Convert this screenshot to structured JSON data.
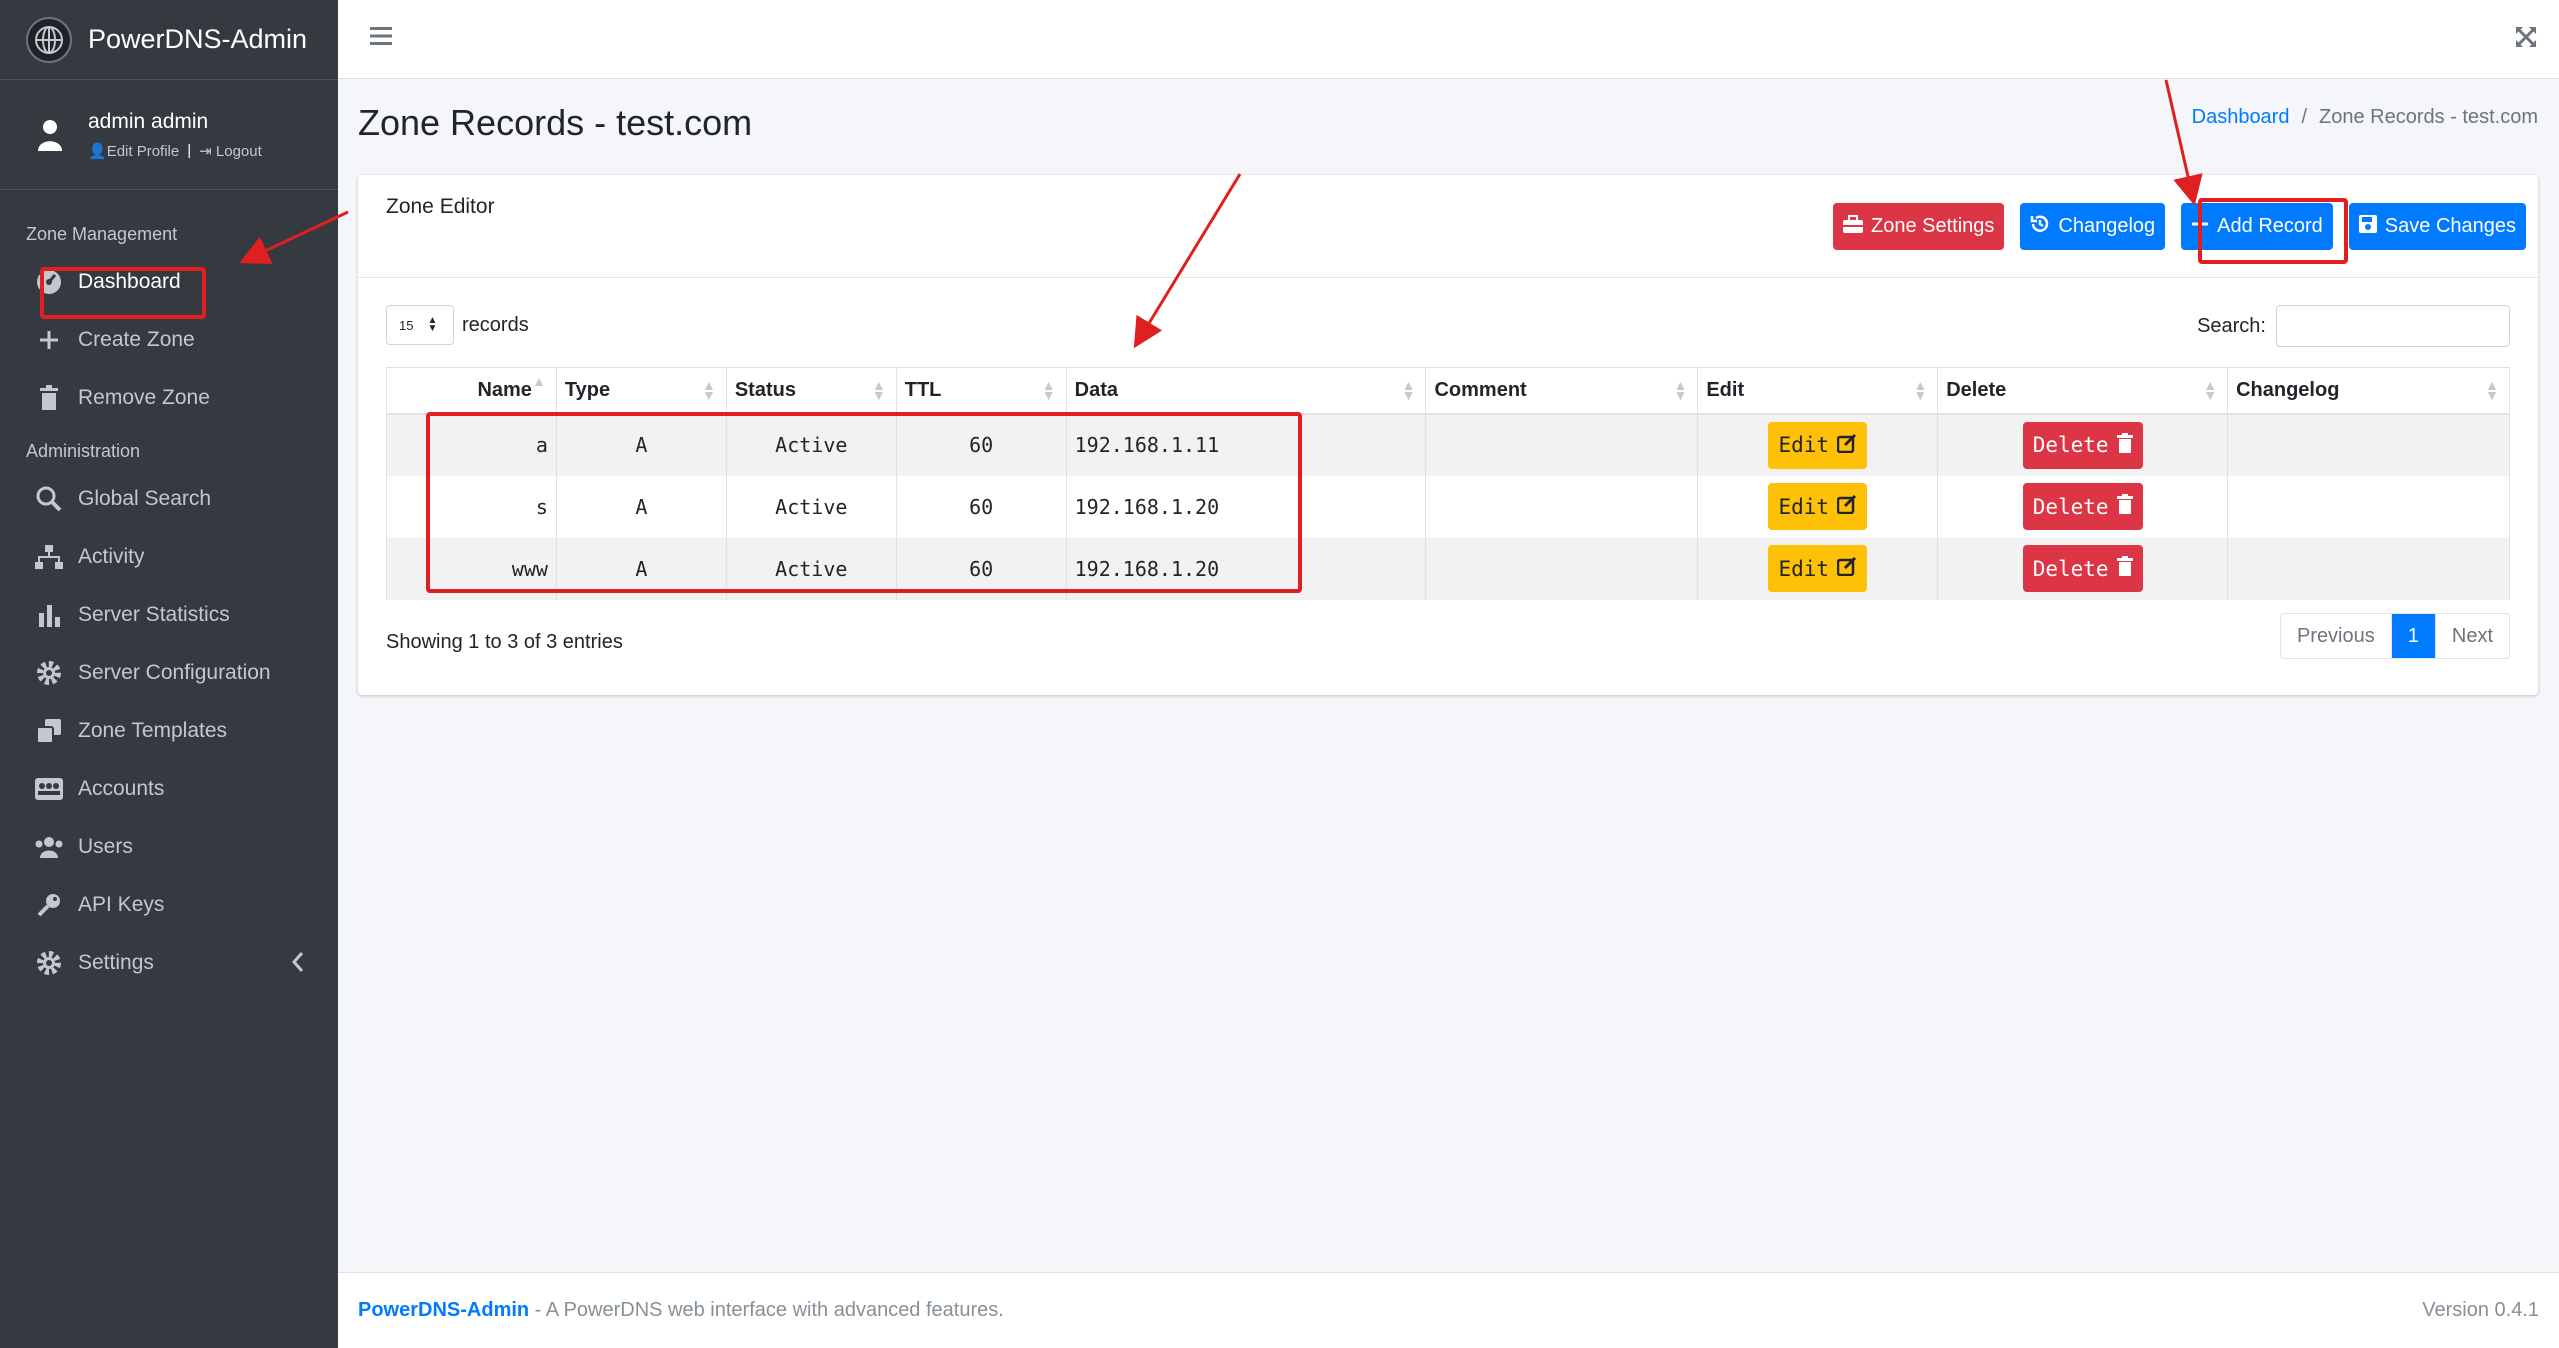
{
  "brand": {
    "name": "PowerDNS-Admin"
  },
  "user": {
    "name": "admin admin",
    "edit_profile": "Edit Profile",
    "logout": "Logout",
    "separator": "|"
  },
  "sidebar": {
    "sections": [
      {
        "header": "Zone Management",
        "items": [
          {
            "label": "Dashboard",
            "icon": "dashboard-icon"
          },
          {
            "label": "Create Zone",
            "icon": "plus-icon"
          },
          {
            "label": "Remove Zone",
            "icon": "trash-icon"
          }
        ]
      },
      {
        "header": "Administration",
        "items": [
          {
            "label": "Global Search",
            "icon": "search-icon"
          },
          {
            "label": "Activity",
            "icon": "sitemap-icon"
          },
          {
            "label": "Server Statistics",
            "icon": "chart-icon"
          },
          {
            "label": "Server Configuration",
            "icon": "gear-icon"
          },
          {
            "label": "Zone Templates",
            "icon": "clone-icon"
          },
          {
            "label": "Accounts",
            "icon": "accounts-icon"
          },
          {
            "label": "Users",
            "icon": "users-icon"
          },
          {
            "label": "API Keys",
            "icon": "key-icon"
          },
          {
            "label": "Settings",
            "icon": "gear-icon"
          }
        ]
      }
    ]
  },
  "page": {
    "title": "Zone Records - test.com"
  },
  "breadcrumb": {
    "home": "Dashboard",
    "sep": "/",
    "current": "Zone Records - test.com"
  },
  "card": {
    "title": "Zone Editor",
    "buttons": {
      "zone_settings": "Zone Settings",
      "changelog": "Changelog",
      "add_record": "Add Record",
      "save_changes": "Save Changes"
    }
  },
  "table_controls": {
    "length_value": "15",
    "length_label": "records",
    "search_label": "Search:",
    "search_value": ""
  },
  "table": {
    "columns": [
      "Name",
      "Type",
      "Status",
      "TTL",
      "Data",
      "Comment",
      "Edit",
      "Delete",
      "Changelog"
    ],
    "rows": [
      {
        "name": "a",
        "type": "A",
        "status": "Active",
        "ttl": "60",
        "data": "192.168.1.11",
        "comment": "",
        "edit": "Edit",
        "delete": "Delete"
      },
      {
        "name": "s",
        "type": "A",
        "status": "Active",
        "ttl": "60",
        "data": "192.168.1.20",
        "comment": "",
        "edit": "Edit",
        "delete": "Delete"
      },
      {
        "name": "www",
        "type": "A",
        "status": "Active",
        "ttl": "60",
        "data": "192.168.1.20",
        "comment": "",
        "edit": "Edit",
        "delete": "Delete"
      }
    ]
  },
  "info": "Showing 1 to 3 of 3 entries",
  "pager": {
    "previous": "Previous",
    "current": "1",
    "next": "Next"
  },
  "footer": {
    "brand": "PowerDNS-Admin",
    "tagline": " - A PowerDNS web interface with advanced features.",
    "version": "Version 0.4.1"
  },
  "colors": {
    "sidebar": "#343a40",
    "primary": "#007bff",
    "danger": "#dc3545",
    "warning": "#ffc107",
    "annotation": "#e02020"
  }
}
